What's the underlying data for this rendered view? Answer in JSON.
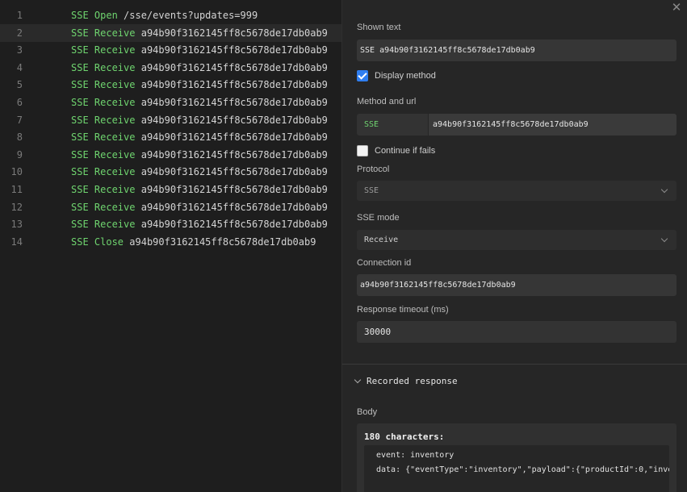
{
  "editor": {
    "lines": [
      {
        "num": "1",
        "keyword": "SSE Open",
        "arg": "/sse/events?updates=999"
      },
      {
        "num": "2",
        "keyword": "SSE Receive",
        "arg": "a94b90f3162145ff8c5678de17db0ab9"
      },
      {
        "num": "3",
        "keyword": "SSE Receive",
        "arg": "a94b90f3162145ff8c5678de17db0ab9"
      },
      {
        "num": "4",
        "keyword": "SSE Receive",
        "arg": "a94b90f3162145ff8c5678de17db0ab9"
      },
      {
        "num": "5",
        "keyword": "SSE Receive",
        "arg": "a94b90f3162145ff8c5678de17db0ab9"
      },
      {
        "num": "6",
        "keyword": "SSE Receive",
        "arg": "a94b90f3162145ff8c5678de17db0ab9"
      },
      {
        "num": "7",
        "keyword": "SSE Receive",
        "arg": "a94b90f3162145ff8c5678de17db0ab9"
      },
      {
        "num": "8",
        "keyword": "SSE Receive",
        "arg": "a94b90f3162145ff8c5678de17db0ab9"
      },
      {
        "num": "9",
        "keyword": "SSE Receive",
        "arg": "a94b90f3162145ff8c5678de17db0ab9"
      },
      {
        "num": "10",
        "keyword": "SSE Receive",
        "arg": "a94b90f3162145ff8c5678de17db0ab9"
      },
      {
        "num": "11",
        "keyword": "SSE Receive",
        "arg": "a94b90f3162145ff8c5678de17db0ab9"
      },
      {
        "num": "12",
        "keyword": "SSE Receive",
        "arg": "a94b90f3162145ff8c5678de17db0ab9"
      },
      {
        "num": "13",
        "keyword": "SSE Receive",
        "arg": "a94b90f3162145ff8c5678de17db0ab9"
      },
      {
        "num": "14",
        "keyword": "SSE Close",
        "arg": "a94b90f3162145ff8c5678de17db0ab9"
      }
    ]
  },
  "panel": {
    "close_icon": "close-icon",
    "shown_text": {
      "label": "Shown text",
      "value": "SSE a94b90f3162145ff8c5678de17db0ab9"
    },
    "display_method": {
      "label": "Display method",
      "checked": true
    },
    "method_url": {
      "label": "Method and url",
      "method": "SSE",
      "url": "a94b90f3162145ff8c5678de17db0ab9"
    },
    "continue_if_fails": {
      "label": "Continue if fails",
      "checked": false
    },
    "protocol": {
      "label": "Protocol",
      "value": "SSE"
    },
    "sse_mode": {
      "label": "SSE mode",
      "value": "Receive"
    },
    "connection_id": {
      "label": "Connection id",
      "value": "a94b90f3162145ff8c5678de17db0ab9"
    },
    "response_timeout": {
      "label": "Response timeout (ms)",
      "value": "30000"
    },
    "recorded": {
      "title": "Recorded response",
      "body_label": "Body",
      "chars": "180 characters:",
      "lines": [
        "event: inventory",
        "data: {\"eventType\":\"inventory\",\"payload\":{\"productId\":0,\"inve"
      ]
    }
  },
  "colors": {
    "accent": "#2f7ef0",
    "keyword": "#6fd46f",
    "background": "#1e1e1e",
    "panel": "#262626"
  }
}
